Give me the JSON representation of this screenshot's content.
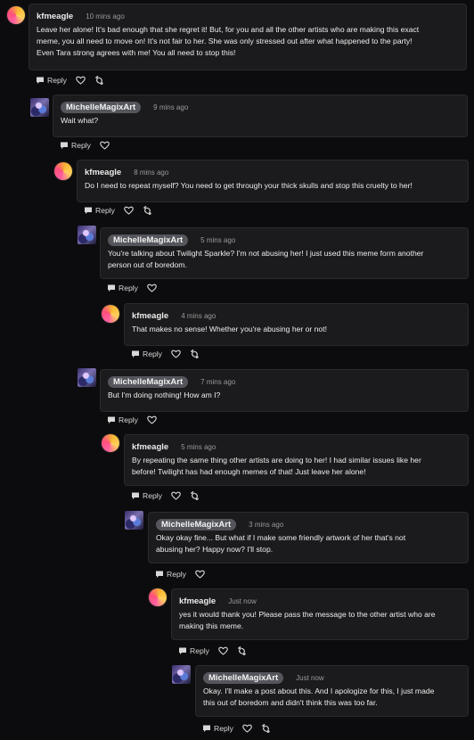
{
  "comments": [
    {
      "user": "kfmeagle",
      "time": "10 mins ago",
      "text": [
        "Leave her alone! It's bad enough that she regret it! But, for you and all the other artists who are making this exact",
        "meme, you all need to move on! It's not fair to her. She was only stressed out after what happened to the party!",
        "Even Tara strong agrees with me! You all need to stop this!"
      ],
      "reply": "Reply",
      "has_share": true
    },
    {
      "user": "MichelleMagixArt",
      "time": "9 mins ago",
      "text": [
        "Wait what?"
      ],
      "reply": "Reply",
      "has_share": false
    },
    {
      "user": "kfmeagle",
      "time": "8 mins ago",
      "text": [
        "Do I need to repeat myself? You need to get through your thick skulls and stop this cruelty to her!"
      ],
      "reply": "Reply",
      "has_share": true
    },
    {
      "user": "MichelleMagixArt",
      "time": "5 mins ago",
      "text": [
        "You're talking about Twilight Sparkle? I'm not abusing her! I just used this meme form another",
        "person out of boredom."
      ],
      "reply": "Reply",
      "has_share": false
    },
    {
      "user": "kfmeagle",
      "time": "4 mins ago",
      "text": [
        "That makes no sense! Whether you're abusing her or not!"
      ],
      "reply": "Reply",
      "has_share": true
    },
    {
      "user": "MichelleMagixArt",
      "time": "7 mins ago",
      "text": [
        "But I'm doing nothing! How am I?"
      ],
      "reply": "Reply",
      "has_share": false
    },
    {
      "user": "kfmeagle",
      "time": "5 mins ago",
      "text": [
        "By repeating the same thing other artists are doing to her! I had similar issues like her",
        "before! Twilight has had enough memes of that! Just leave her alone!"
      ],
      "reply": "Reply",
      "has_share": true
    },
    {
      "user": "MichelleMagixArt",
      "time": "3 mins ago",
      "text": [
        "Okay okay fine... But what if I make some friendly artwork of her that's not",
        "abusing her? Happy now? I'll stop."
      ],
      "reply": "Reply",
      "has_share": false
    },
    {
      "user": "kfmeagle",
      "time": "Just now",
      "text": [
        "yes it would thank you! Please pass the message to the other artist who are",
        "making this meme."
      ],
      "reply": "Reply",
      "has_share": true
    },
    {
      "user": "MichelleMagixArt",
      "time": "Just now",
      "text": [
        "Okay. I'll make a post about this. And I apologize for this, I just made",
        "this out of boredom and didn't think this was too far."
      ],
      "reply": "Reply",
      "has_share": true
    }
  ]
}
